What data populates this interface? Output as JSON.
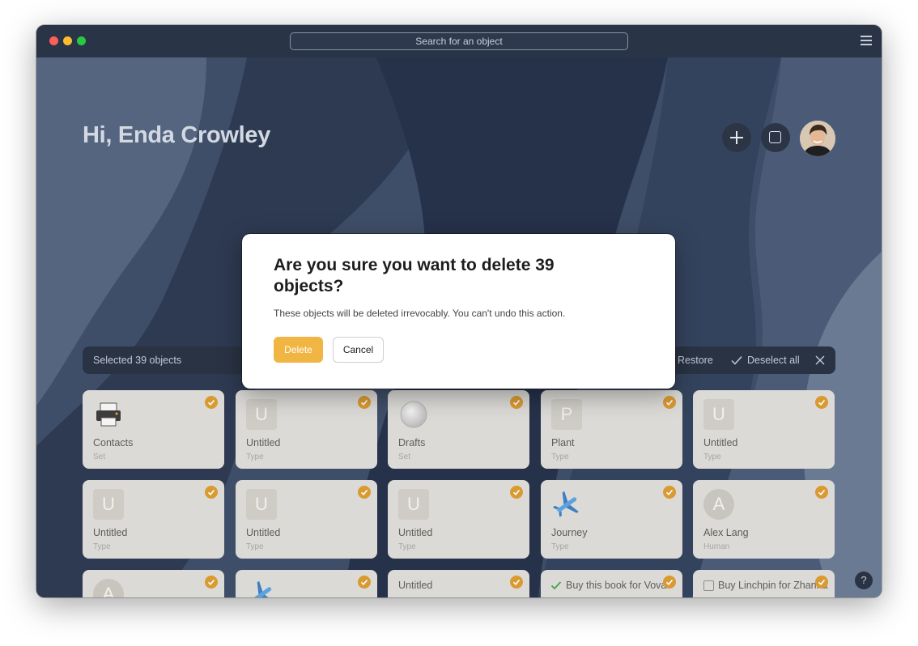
{
  "window": {
    "search_placeholder": "Search for an object"
  },
  "dashboard": {
    "greeting": "Hi, Enda Crowley",
    "avatar_icon": "user-avatar"
  },
  "selection_bar": {
    "selected_label": "Selected 39 objects",
    "restore_label": "Restore",
    "deselect_label": "Deselect all"
  },
  "cards": [
    {
      "title": "Contacts",
      "type": "Set",
      "icon": "printer-emoji"
    },
    {
      "title": "Untitled",
      "type": "Type",
      "icon": "U"
    },
    {
      "title": "Drafts",
      "type": "Set",
      "icon": "white-circle"
    },
    {
      "title": "Plant",
      "type": "Type",
      "icon": "P"
    },
    {
      "title": "Untitled",
      "type": "Type",
      "icon": "U"
    },
    {
      "title": "Untitled",
      "type": "Type",
      "icon": "U"
    },
    {
      "title": "Untitled",
      "type": "Type",
      "icon": "U"
    },
    {
      "title": "Untitled",
      "type": "Type",
      "icon": "U"
    },
    {
      "title": "Journey",
      "type": "Type",
      "icon": "airplane-emoji"
    },
    {
      "title": "Alex Lang",
      "type": "Human",
      "icon": "A"
    },
    {
      "title": "",
      "type": "",
      "icon": "A"
    },
    {
      "title": "",
      "type": "",
      "icon": "airplane-emoji"
    },
    {
      "title": "Untitled",
      "type": "",
      "icon": ""
    },
    {
      "title": "Buy this book for Vova",
      "type": "",
      "icon": "checked-task"
    },
    {
      "title": "Buy Linchpin for Zhanna",
      "type": "",
      "icon": "unchecked-task"
    }
  ],
  "modal": {
    "title": "Are you sure you want to delete 39 objects?",
    "message": "These objects will be deleted irrevocably. You can't undo this action.",
    "delete_label": "Delete",
    "cancel_label": "Cancel"
  },
  "help_label": "?",
  "colors": {
    "accent": "#f1b544",
    "check_badge": "#d99a32",
    "background": "#3b4a63"
  }
}
